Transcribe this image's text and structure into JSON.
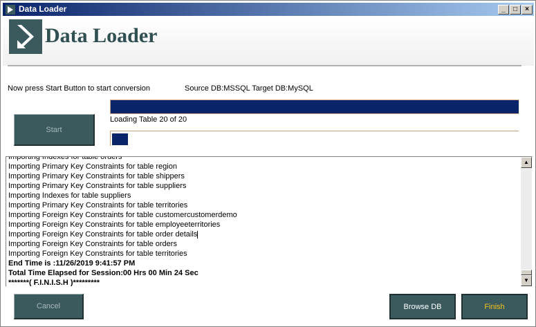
{
  "window": {
    "title": "Data Loader"
  },
  "header": {
    "app_title": "Data Loader"
  },
  "status": {
    "instruction": "Now press Start Button to start conversion",
    "db_info": "Source DB:MSSQL Target DB:MySQL"
  },
  "buttons": {
    "start": "Start",
    "cancel": "Cancel",
    "browse_db": "Browse DB",
    "finish": "Finish"
  },
  "progress": {
    "overall_fraction": 1.0,
    "loading_text": "Loading Table 20 of 20",
    "table_fraction": 0.04
  },
  "log": {
    "lines": [
      {
        "text": "Importing Indexes for table orders",
        "bold": false
      },
      {
        "text": "Importing Primary Key Constraints for table region",
        "bold": false
      },
      {
        "text": "Importing Primary Key Constraints for table shippers",
        "bold": false
      },
      {
        "text": "Importing Primary Key Constraints for table suppliers",
        "bold": false
      },
      {
        "text": "Importing Indexes for table suppliers",
        "bold": false
      },
      {
        "text": "Importing Primary Key Constraints for table territories",
        "bold": false
      },
      {
        "text": "Importing Foreign Key Constraints for table customercustomerdemo",
        "bold": false
      },
      {
        "text": "Importing Foreign Key Constraints for table employeeterritories",
        "bold": false
      },
      {
        "text": "Importing Foreign Key Constraints for table order details",
        "bold": false
      },
      {
        "text": "Importing Foreign Key Constraints for table orders",
        "bold": false
      },
      {
        "text": "Importing Foreign Key Constraints for table territories",
        "bold": false
      },
      {
        "text": "End Time is :11/26/2019 9:41:57 PM",
        "bold": true
      },
      {
        "text": "Total Time Elapsed for Session:00 Hrs 00 Min 24 Sec",
        "bold": true
      },
      {
        "text": "*******( F.I.N.I.S.H )*********",
        "bold": true
      }
    ]
  },
  "icons": {
    "minimize": "minimize-icon",
    "maximize": "maximize-icon",
    "close": "close-icon",
    "scroll_up": "arrow-up-icon",
    "scroll_down": "arrow-down-icon"
  },
  "colors": {
    "title_bar": "#0a246a",
    "accent_dark": "#3b5a5e",
    "progress_fill": "#0a246a",
    "finish_text": "#f0c419"
  }
}
